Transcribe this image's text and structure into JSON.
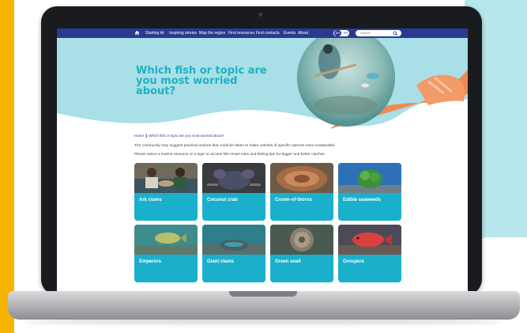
{
  "nav": {
    "items": [
      "Starting kit",
      "Inspiring stories",
      "Map the region",
      "Find resources",
      "Find contacts",
      "Events",
      "About"
    ],
    "lang": [
      "EN",
      "FR"
    ],
    "search_placeholder": "Search"
  },
  "hero": {
    "title": "Which fish or topic are you most worried about?"
  },
  "breadcrumb": "Home ❯ Which fish or topic are you most worried about?",
  "intro": [
    "The community may suggest practical actions that could be taken to make catches of specific species more sustainable.",
    "Please select a marine resource or a topic to access fish smart rules and fishing tips for bigger and better catches."
  ],
  "tiles": [
    {
      "label": "Ark clams"
    },
    {
      "label": "Coconut crab"
    },
    {
      "label": "Crown-of-thorns"
    },
    {
      "label": "Edible seaweeds"
    },
    {
      "label": "Emperors"
    },
    {
      "label": "Giant clams"
    },
    {
      "label": "Green snail"
    },
    {
      "label": "Groupers"
    }
  ],
  "colors": {
    "navbar": "#2a3b8f",
    "accent_teal": "#1fb0c5",
    "hero_bg": "#a9dfe6",
    "accent_orange": "#ef8a55",
    "tile": "#1ab0cc",
    "frame_yellow": "#f5b400",
    "bubble": "#b7e6ec"
  }
}
